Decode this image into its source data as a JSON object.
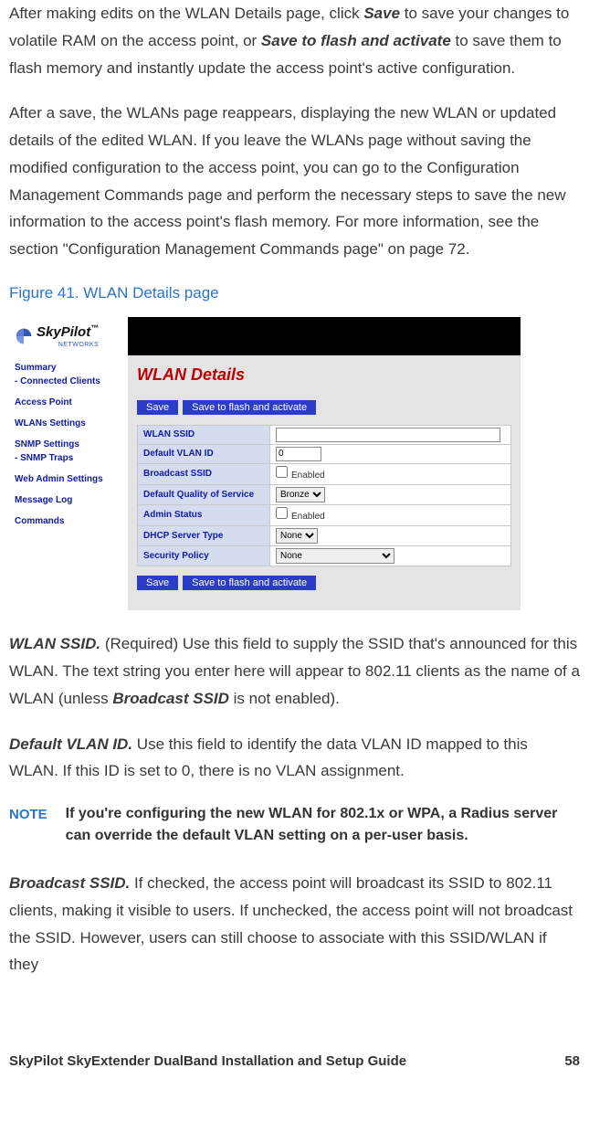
{
  "para1": {
    "a": "After making edits on the WLAN Details page, click ",
    "save": "Save",
    "b": " to save your changes to volatile RAM on the access point, or ",
    "saveflash": "Save to flash and activate",
    "c": " to save them to flash memory and instantly update the access point's active configuration."
  },
  "para2": "After a save, the WLANs page reappears, displaying the new WLAN or updated details of the edited WLAN. If you leave the WLANs page without saving the modified configuration to the access point, you can go to the Configuration Management Commands page and perform the necessary steps to save the new information to the access point's flash memory. For more information, see the section \"Configuration Management Commands page\" on page 72.",
  "figcap": "Figure 41. WLAN Details page",
  "shot": {
    "logo_brand": "SkyPilot",
    "logo_tm": "™",
    "logo_sub": "NETWORKS",
    "nav": [
      "Summary",
      "- Connected Clients",
      "Access Point",
      "WLANs Settings",
      "SNMP Settings",
      "- SNMP Traps",
      "Web Admin Settings",
      "Message Log",
      "Commands"
    ],
    "title": "WLAN Details",
    "btn_save": "Save",
    "btn_flash": "Save to flash and activate",
    "rows": {
      "ssid_label": "WLAN SSID",
      "ssid_val": "",
      "vlan_label": "Default VLAN ID",
      "vlan_val": "0",
      "bcast_label": "Broadcast SSID",
      "bcast_enabled": "Enabled",
      "qos_label": "Default Quality of Service",
      "qos_val": "Bronze",
      "admin_label": "Admin Status",
      "admin_enabled": "Enabled",
      "dhcp_label": "DHCP Server Type",
      "dhcp_val": "None",
      "sec_label": "Security Policy",
      "sec_val": "None"
    }
  },
  "field_ssid": {
    "term": "WLAN SSID.",
    "a": " (Required) Use this field to supply the SSID that's announced for this WLAN. The text string you enter here will appear to 802.11 clients as the name of a WLAN (unless ",
    "bcast": "Broadcast SSID",
    "b": " is not enabled)."
  },
  "field_vlan": {
    "term": "Default VLAN ID.",
    "body": " Use this field to identify the data VLAN ID mapped to this WLAN. If this ID is set to 0, there is no VLAN assignment."
  },
  "note": {
    "label": "NOTE",
    "body": "If you're configuring the new WLAN for 802.1x or WPA, a Radius server can override the default VLAN setting on a per-user basis."
  },
  "field_bcast": {
    "term": "Broadcast SSID.",
    "body": " If checked, the access point will broadcast its SSID to 802.11 clients, making it visible to users. If unchecked, the access point will not broadcast the SSID. However, users can still choose to associate with this SSID/WLAN if they"
  },
  "footer": {
    "left": "SkyPilot SkyExtender DualBand Installation and Setup Guide",
    "right": "58"
  }
}
